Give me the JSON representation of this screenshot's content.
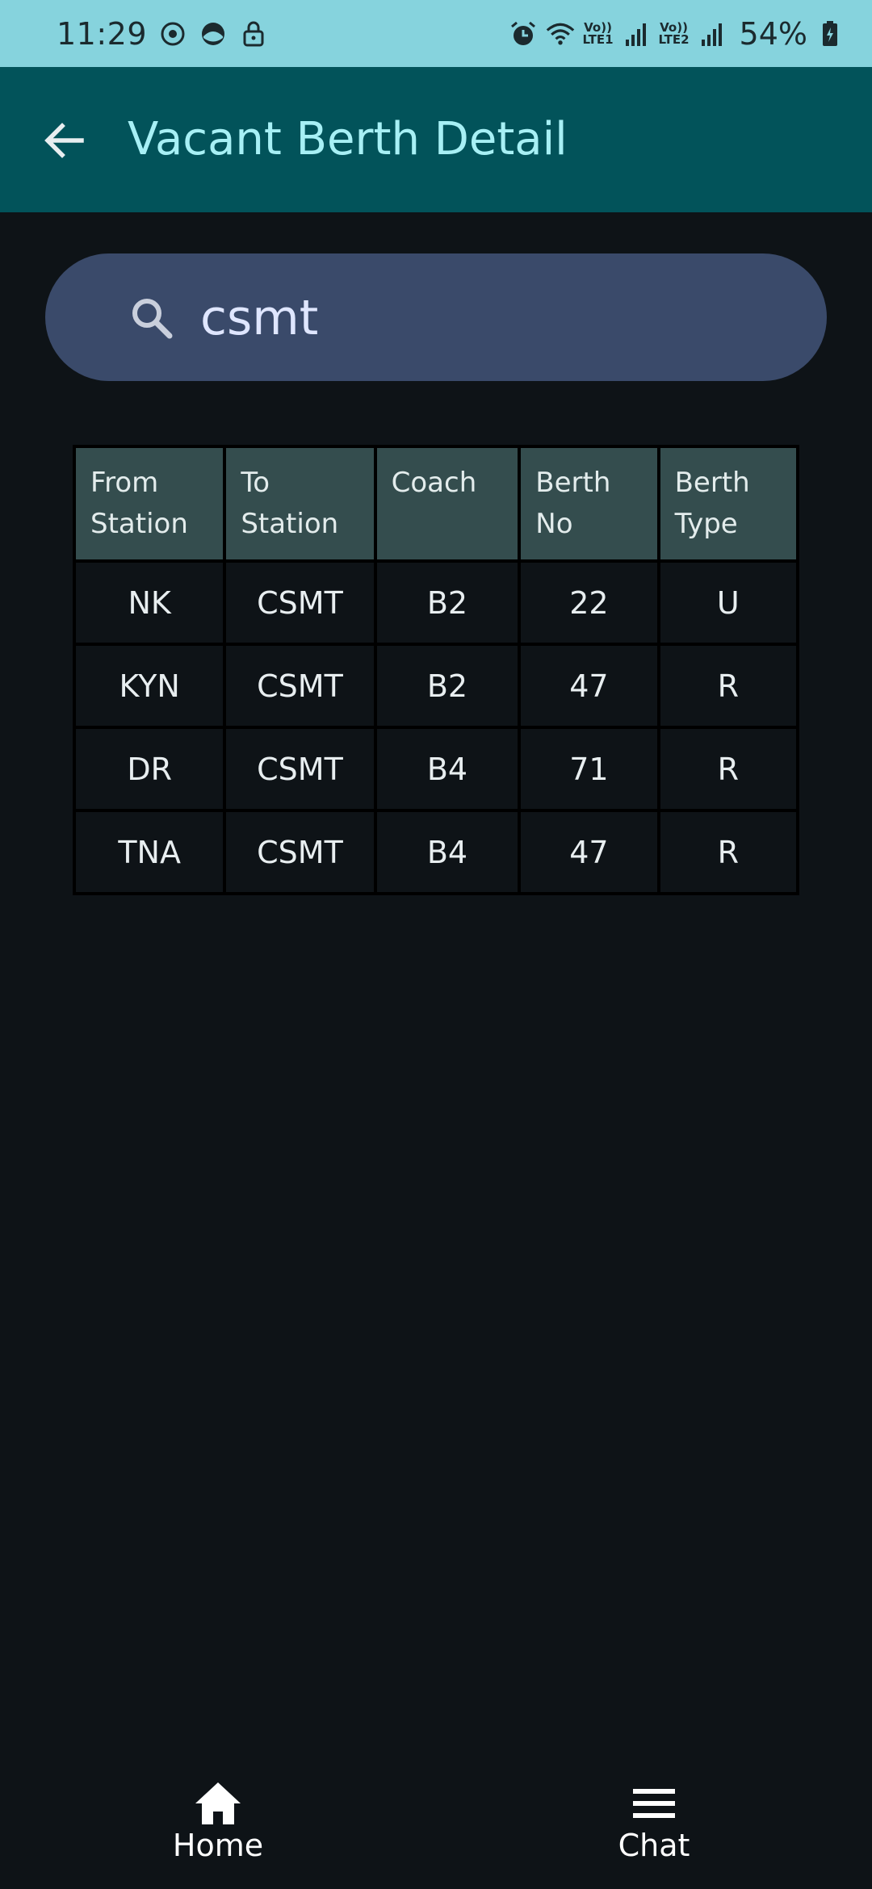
{
  "status_bar": {
    "time": "11:29",
    "net1": "Vo))\nLTE1",
    "net2": "Vo))\nLTE2",
    "battery": "54%"
  },
  "app_bar": {
    "title": "Vacant Berth Detail"
  },
  "search": {
    "value": "csmt"
  },
  "table": {
    "headers": [
      "From\nStation",
      "To\nStation",
      "Coach",
      "Berth\nNo",
      "Berth\nType"
    ],
    "rows": [
      [
        "NK",
        "CSMT",
        "B2",
        "22",
        "U"
      ],
      [
        "KYN",
        "CSMT",
        "B2",
        "47",
        "R"
      ],
      [
        "DR",
        "CSMT",
        "B4",
        "71",
        "R"
      ],
      [
        "TNA",
        "CSMT",
        "B4",
        "47",
        "R"
      ]
    ]
  },
  "bottom_nav": {
    "home_label": "Home",
    "chat_label": "Chat"
  },
  "colors": {
    "status_bar": "#86d3dd",
    "app_bar": "#02535a",
    "title": "#a7f0f5",
    "search_bg": "#3a4a6a",
    "header_cell": "#344d4e",
    "background": "#0e1317"
  }
}
